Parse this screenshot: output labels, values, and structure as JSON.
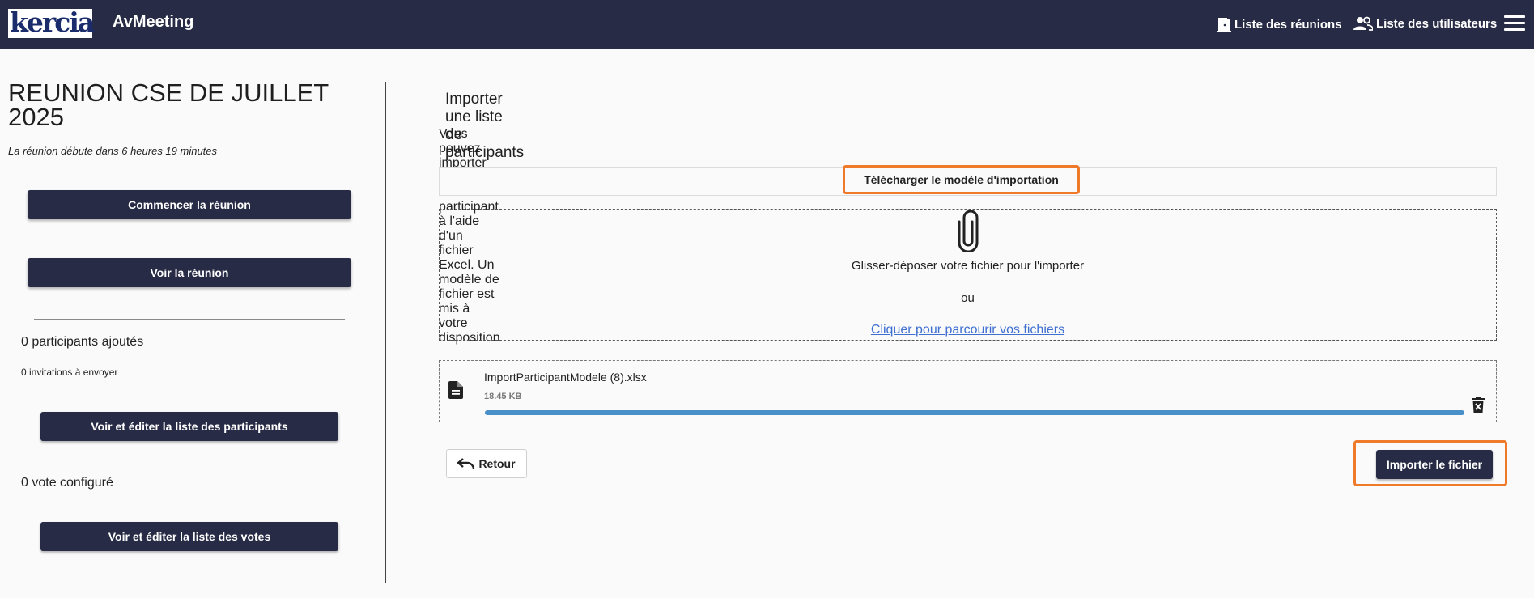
{
  "header": {
    "logo_text": "kercia",
    "app_title": "AvMeeting",
    "nav": {
      "meetings": "Liste des réunions",
      "users": "Liste des utilisateurs"
    }
  },
  "meeting": {
    "title": "REUNION CSE DE JUILLET 2025",
    "starts_in": "La réunion débute dans 6 heures 19 minutes",
    "start_button": "Commencer la réunion",
    "view_button": "Voir la réunion",
    "participants_count": "0 participants ajoutés",
    "invitations_count": "0 invitations à envoyer",
    "participants_button": "Voir et éditer la liste des participants",
    "votes_count": "0 vote configuré",
    "votes_button": "Voir et éditer la liste des votes"
  },
  "import": {
    "title": "Importer une liste de participants",
    "description": "Vous pouvez importer une liste de participant à l'aide d'un fichier Excel. Un modèle de fichier est mis à votre disposition",
    "template_button": "Télécharger le modèle d'importation",
    "dropzone": {
      "text": "Glisser-déposer votre fichier pour l'importer",
      "or": "ou",
      "browse_link": "Cliquer pour parcourir vos fichiers"
    },
    "file": {
      "name": "ImportParticipantModele (8).xlsx",
      "size": "18.45 KB",
      "progress": 1.0
    },
    "back_button": "Retour",
    "import_button": "Importer le fichier"
  },
  "colors": {
    "topbar": "#272b45",
    "highlight": "#ee7a2a",
    "link": "#3f6fd1",
    "progress": "#4a90c8"
  }
}
